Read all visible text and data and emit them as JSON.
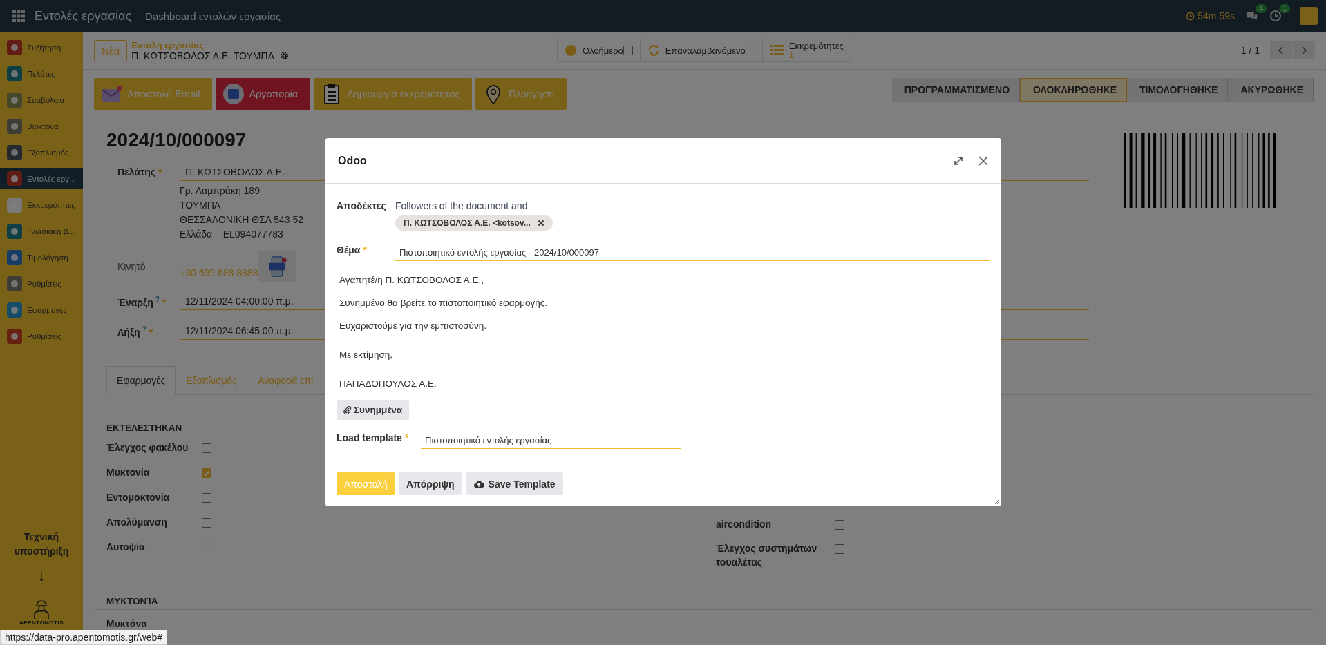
{
  "navbar": {
    "app_title": "Εντολές εργασίας",
    "menu": "Dashboard εντολών εργασίας",
    "timer": "54m 59s",
    "messages_badge": "4",
    "activities_badge": "1"
  },
  "sidebar": {
    "items": [
      {
        "label": "Συζήτηση",
        "selected": false
      },
      {
        "label": "Πελάτες",
        "selected": false
      },
      {
        "label": "Συμβόλαια",
        "selected": false
      },
      {
        "label": "Βιοκτόνα",
        "selected": false
      },
      {
        "label": "Εξοπλισμός",
        "selected": false
      },
      {
        "label": "Εντολές εργ...",
        "selected": true
      },
      {
        "label": "Εκκρεμότητες",
        "selected": false
      },
      {
        "label": "Γνωσιακή β...",
        "selected": false
      },
      {
        "label": "Τιμολόγηση",
        "selected": false
      },
      {
        "label": "Ρυθμίσεις",
        "selected": false
      },
      {
        "label": "Εφαρμογές",
        "selected": false
      },
      {
        "label": "Ρυθμίσεις",
        "selected": false
      }
    ],
    "support_label": "Τεχνική υποστήριξη",
    "arrow": "↓",
    "logo_text": "APENTOMOTIS"
  },
  "control_panel": {
    "new_button": "Νέα",
    "breadcrumb": "Εντολή εργασίας",
    "record_name": "Π. ΚΩΤΣΟΒΟΛΟΣ Α.Ε. ΤΟΥΜΠΑ",
    "toggles": [
      {
        "kind": "checkbox",
        "label": "Ολοήμερο",
        "checked": false
      },
      {
        "kind": "checkbox",
        "label": "Επαναλαμβανόμενο",
        "checked": false
      },
      {
        "kind": "counter",
        "label": "Εκκρεμότητες",
        "count": "1"
      }
    ],
    "pager": "1 / 1"
  },
  "action_buttons": [
    {
      "label": "Αποστολή Email",
      "kind": "warning"
    },
    {
      "label": "Αργοπορία",
      "kind": "danger"
    },
    {
      "label": "Δημιουργία εκκρεμότητας",
      "kind": "warning"
    },
    {
      "label": "Πλοήγηση",
      "kind": "warning"
    }
  ],
  "stages": [
    {
      "label": "ΠΡΟΓΡΑΜΜΑΤΙΣΜΕΝΟ",
      "selected": false
    },
    {
      "label": "ΟΛΟΚΛΗΡΩΘΗΚΕ",
      "selected": true
    },
    {
      "label": "ΤΙΜΟΛΟΓΗΘΗΚΕ",
      "selected": false
    },
    {
      "label": "ΑΚΥΡΩΘΗΚΕ",
      "selected": false
    }
  ],
  "form": {
    "title": "2024/10/000097",
    "customer": {
      "label": "Πελάτης",
      "required_mark": "*",
      "value": "Π. ΚΩΤΣΟΒΟΛΟΣ Α.Ε.",
      "address_lines": [
        "Γρ. Λαμπράκη 189",
        "ΤΟΥΜΠΑ",
        "ΘΕΣΣΑΛΟΝΙΚΗ ΘΣΛ 543 52",
        "Ελλάδα – EL094077783"
      ]
    },
    "mobile": {
      "label": "Κινητό",
      "value": "+30 699 688 8888"
    },
    "dates": [
      {
        "label": "Έναρξη",
        "help_mark": "?",
        "required_mark": "*",
        "value": "12/11/2024 04:00:00 π.μ."
      },
      {
        "label": "Λήξη",
        "help_mark": "?",
        "required_mark": "*",
        "value": "12/11/2024 06:45:00 π.μ."
      }
    ],
    "tabs": [
      {
        "label": "Εφαρμογές",
        "selected": true
      },
      {
        "label": "Εξοπλισμός",
        "selected": false
      },
      {
        "label": "Αναφορά επί",
        "selected": false
      }
    ],
    "done_section": {
      "title": "ΕΚΤΕΛΕΣΤΗΚΑΝ",
      "left": [
        {
          "label": "Έλεγχος φακέλου",
          "checked": false
        },
        {
          "label": "Μυκτονία",
          "checked": true
        },
        {
          "label": "Εντομοκτονία",
          "checked": false
        },
        {
          "label": "Απολύμανση",
          "checked": false
        },
        {
          "label": "Αυτοψία",
          "checked": false
        }
      ],
      "right": [
        {
          "label": "aircondition",
          "checked": false
        },
        {
          "label": "Έλεγχος συστημάτων τουαλέτας",
          "checked": false
        }
      ]
    },
    "rodent_section": {
      "title": "ΜΥΚΤΟΝΊΑ",
      "field_label": "Μυκτόνα"
    }
  },
  "dialog": {
    "title": "Odoo",
    "recipients_label": "Αποδέκτες",
    "recipients_text": "Followers of the document and",
    "recipient_tags": [
      "Π. ΚΩΤΣΟΒΟΛΟΣ Α.Ε. <kotsov..."
    ],
    "subject_label": "Θέμα",
    "subject_required_mark": "*",
    "subject": "Πιστοποιητικό εντολής εργασίας - 2024/10/000097",
    "body": [
      "Αγαπητέ/η Π. ΚΩΤΣΟΒΟΛΟΣ Α.Ε.,",
      "Συνημμένο θα βρείτε το πιστοποιητικό εφαρμογής.",
      "Ευχαριστούμε για την εμπιστοσύνη.",
      "Με εκτίμηση,",
      "ΠΑΠΑΔΟΠΟΥΛΟΣ Α.Ε."
    ],
    "attachments_button": "Συνημμένα",
    "template_label": "Load template",
    "template_required_mark": "*",
    "template": "Πιστοποιητικό εντολής εργασίας",
    "buttons": [
      {
        "label": "Αποστολή",
        "kind": "primary"
      },
      {
        "label": "Απόρριψη",
        "kind": "secondary"
      },
      {
        "label": "Save Template",
        "kind": "upload"
      }
    ]
  },
  "status_url": "https://data-pro.apentomotis.gr/web#"
}
